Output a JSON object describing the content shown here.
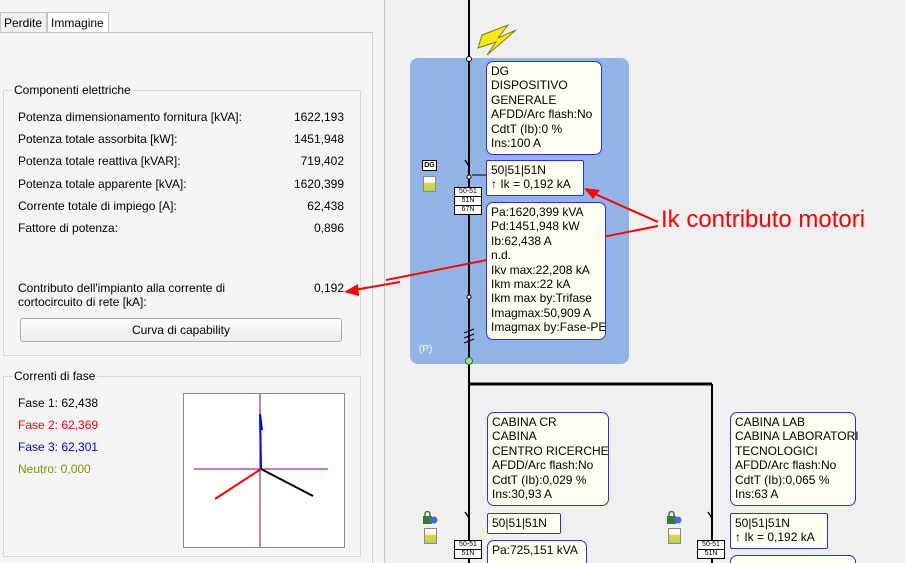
{
  "tabs": [
    {
      "label": "Perdite"
    },
    {
      "label": "Immagine"
    }
  ],
  "componenti": {
    "title": "Componenti elettriche",
    "rows": [
      {
        "label": "Potenza dimensionamento fornitura [kVA]:",
        "value": "1622,193"
      },
      {
        "label": "Potenza totale assorbita [kW]:",
        "value": "1451,948"
      },
      {
        "label": "Potenza totale reattiva [kVAR]:",
        "value": "719,402"
      },
      {
        "label": "Potenza totale apparente [kVA]:",
        "value": "1620,399"
      },
      {
        "label": "Corrente totale di impiego [A]:",
        "value": "62,438"
      },
      {
        "label": "Fattore di potenza:",
        "value": "0,896"
      }
    ],
    "contributo_label_1": "Contributo dell'impianto alla corrente di",
    "contributo_label_2": "cortocircuito di rete [kA]:",
    "contributo_value": "0,192",
    "button_label": "Curva di capability"
  },
  "correnti": {
    "title": "Correnti di fase",
    "fasi": [
      {
        "label": "Fase 1: 62,438",
        "color": "#000000"
      },
      {
        "label": "Fase 2: 62,369",
        "color": "#ff0000"
      },
      {
        "label": "Fase 3: 62,301",
        "color": "#0000ff"
      },
      {
        "label": "Neutro: 0,000",
        "color": "#8b8b00"
      }
    ]
  },
  "diagram": {
    "dg_card": [
      "DG",
      "DISPOSITIVO",
      "GENERALE",
      "AFDD/Arc flash:No",
      "CdtT (Ib):0 %",
      "Ins:100 A"
    ],
    "dg_prot": [
      "50|51|51N",
      "↑ Ik = 0,192 kA"
    ],
    "dg_results": [
      "Pa:1620,399 kVA",
      "Pd:1451,948 kW",
      "Ib:62,438 A",
      "n.d.",
      "Ikv max:22,208 kA",
      "Ikm max:22 kA",
      "Ikm max by:Trifase",
      "Imagmax:50,909 A",
      "Imagmax by:Fase-PE"
    ],
    "dg_tag": "DG",
    "relay_labels": [
      "50-51",
      "51N",
      "67N"
    ],
    "relay_labels_small": [
      "50-51",
      "51N"
    ],
    "p_label": "(P)",
    "cabina_cr": [
      "CABINA CR",
      "CABINA",
      "CENTRO RICERCHE",
      "AFDD/Arc flash:No",
      "CdtT (Ib):0,029 %",
      "Ins:30,93 A"
    ],
    "cabina_cr_prot": "50|51|51N",
    "cabina_cr_results": "Pa:725,151 kVA",
    "cabina_lab": [
      "CABINA LAB",
      "CABINA LABORATORI",
      "TECNOLOGICI",
      "AFDD/Arc flash:No",
      "CdtT (Ib):0,065 %",
      "Ins:63 A"
    ],
    "cabina_lab_prot": [
      "50|51|51N",
      "↑ Ik = 0,192 kA"
    ],
    "annotation": "Ik contributo motori",
    "colors": {
      "bus": "#000000",
      "panel": "#91b3e6",
      "card_border": "#2d2df0",
      "annotation": "#ff0000",
      "lightning": "#f5e61e"
    }
  }
}
